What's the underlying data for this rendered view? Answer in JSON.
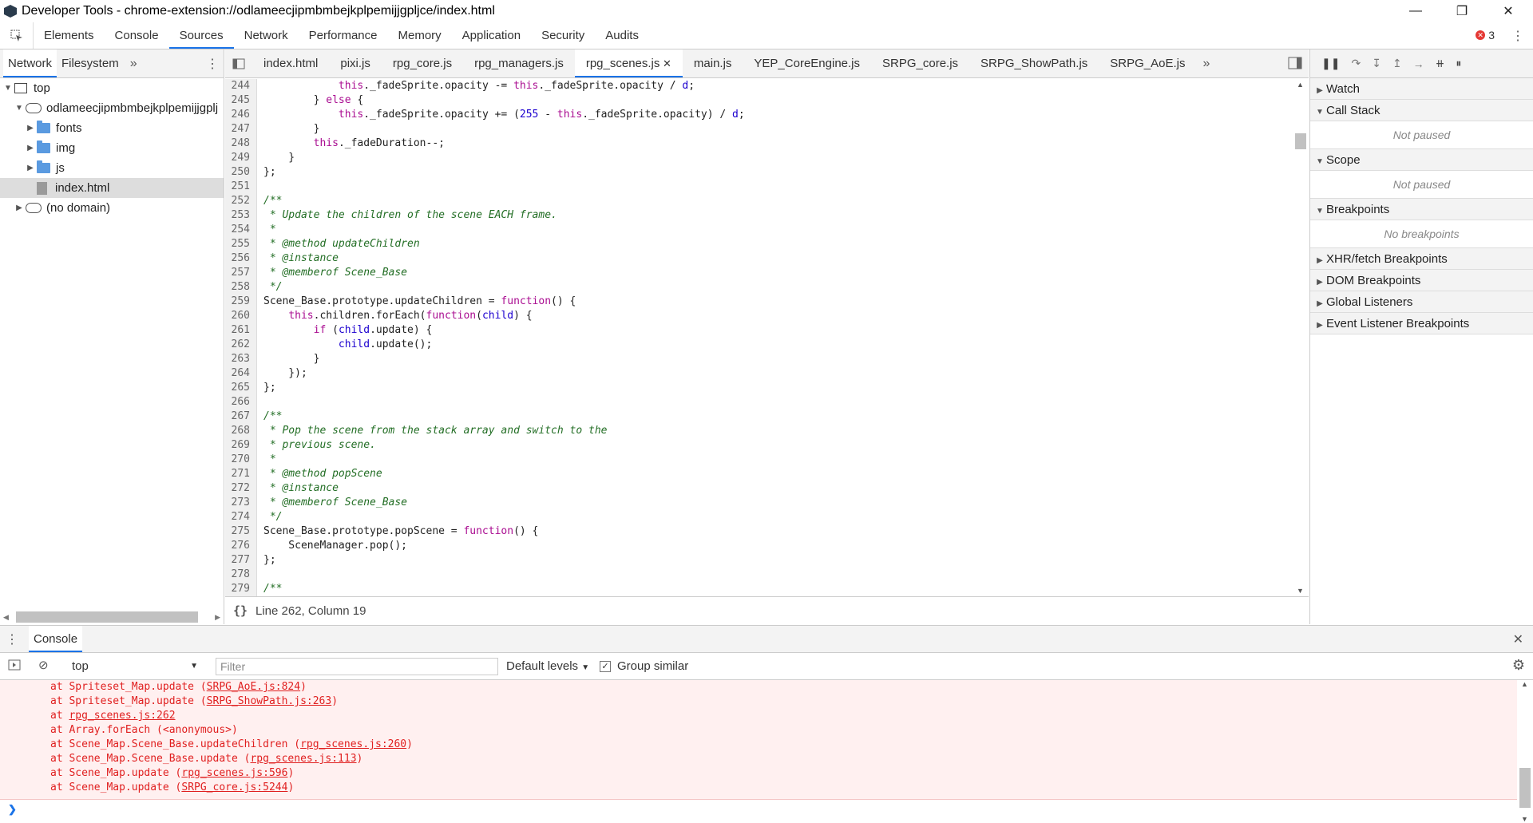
{
  "window": {
    "title": "Developer Tools - chrome-extension://odlameecjipmbmbejkplpemijjgpljce/index.html"
  },
  "main_tabs": [
    "Elements",
    "Console",
    "Sources",
    "Network",
    "Performance",
    "Memory",
    "Application",
    "Security",
    "Audits"
  ],
  "active_main_tab": "Sources",
  "error_count": "3",
  "navigator": {
    "tabs": [
      "Network",
      "Filesystem"
    ],
    "tree": [
      {
        "label": "top",
        "depth": 0,
        "kind": "frame",
        "open": true
      },
      {
        "label": "odlameecjipmbmbejkplpemijjgplj",
        "depth": 1,
        "kind": "cloud",
        "open": true
      },
      {
        "label": "fonts",
        "depth": 2,
        "kind": "folder",
        "open": false
      },
      {
        "label": "img",
        "depth": 2,
        "kind": "folder",
        "open": false
      },
      {
        "label": "js",
        "depth": 2,
        "kind": "folder",
        "open": false
      },
      {
        "label": "index.html",
        "depth": 2,
        "kind": "file",
        "selected": true
      },
      {
        "label": "(no domain)",
        "depth": 1,
        "kind": "cloud",
        "open": false
      }
    ]
  },
  "file_tabs": [
    "index.html",
    "pixi.js",
    "rpg_core.js",
    "rpg_managers.js",
    "rpg_scenes.js",
    "main.js",
    "YEP_CoreEngine.js",
    "SRPG_core.js",
    "SRPG_ShowPath.js",
    "SRPG_AoE.js"
  ],
  "active_file_tab": "rpg_scenes.js",
  "code_lines": [
    [
      "244",
      "            this._fadeSprite.opacity -= this._fadeSprite.opacity / d;"
    ],
    [
      "245",
      "        } else {"
    ],
    [
      "246",
      "            this._fadeSprite.opacity += (255 - this._fadeSprite.opacity) / d;"
    ],
    [
      "247",
      "        }"
    ],
    [
      "248",
      "        this._fadeDuration--;"
    ],
    [
      "249",
      "    }"
    ],
    [
      "250",
      "};"
    ],
    [
      "251",
      ""
    ],
    [
      "252",
      "/**"
    ],
    [
      "253",
      " * Update the children of the scene EACH frame."
    ],
    [
      "254",
      " *"
    ],
    [
      "255",
      " * @method updateChildren"
    ],
    [
      "256",
      " * @instance"
    ],
    [
      "257",
      " * @memberof Scene_Base"
    ],
    [
      "258",
      " */"
    ],
    [
      "259",
      "Scene_Base.prototype.updateChildren = function() {"
    ],
    [
      "260",
      "    this.children.forEach(function(child) {"
    ],
    [
      "261",
      "        if (child.update) {"
    ],
    [
      "262",
      "            child.update();"
    ],
    [
      "263",
      "        }"
    ],
    [
      "264",
      "    });"
    ],
    [
      "265",
      "};"
    ],
    [
      "266",
      ""
    ],
    [
      "267",
      "/**"
    ],
    [
      "268",
      " * Pop the scene from the stack array and switch to the"
    ],
    [
      "269",
      " * previous scene."
    ],
    [
      "270",
      " *"
    ],
    [
      "271",
      " * @method popScene"
    ],
    [
      "272",
      " * @instance"
    ],
    [
      "273",
      " * @memberof Scene_Base"
    ],
    [
      "274",
      " */"
    ],
    [
      "275",
      "Scene_Base.prototype.popScene = function() {"
    ],
    [
      "276",
      "    SceneManager.pop();"
    ],
    [
      "277",
      "};"
    ],
    [
      "278",
      ""
    ],
    [
      "279",
      "/**"
    ]
  ],
  "editor_status": "Line 262, Column 19",
  "debugger": {
    "sections": [
      {
        "label": "Watch",
        "open": false
      },
      {
        "label": "Call Stack",
        "open": true,
        "note": "Not paused"
      },
      {
        "label": "Scope",
        "open": true,
        "note": "Not paused"
      },
      {
        "label": "Breakpoints",
        "open": true,
        "note": "No breakpoints"
      },
      {
        "label": "XHR/fetch Breakpoints",
        "open": false
      },
      {
        "label": "DOM Breakpoints",
        "open": false
      },
      {
        "label": "Global Listeners",
        "open": false
      },
      {
        "label": "Event Listener Breakpoints",
        "open": false
      }
    ]
  },
  "console": {
    "tab": "Console",
    "context": "top",
    "filter_placeholder": "Filter",
    "levels": "Default levels",
    "group_similar": "Group similar",
    "lines": [
      {
        "text": "at Spriteset_Map.update ",
        "link": "SRPG_AoE.js:824"
      },
      {
        "text": "at Spriteset_Map.update ",
        "link": "SRPG_ShowPath.js:263"
      },
      {
        "text": "at ",
        "link": "rpg_scenes.js:262",
        "plain": true
      },
      {
        "text": "at Array.forEach (<anonymous>)",
        "link": ""
      },
      {
        "text": "at Scene_Map.Scene_Base.updateChildren ",
        "link": "rpg_scenes.js:260"
      },
      {
        "text": "at Scene_Map.Scene_Base.update ",
        "link": "rpg_scenes.js:113"
      },
      {
        "text": "at Scene_Map.update ",
        "link": "rpg_scenes.js:596"
      },
      {
        "text": "at Scene_Map.update ",
        "link": "SRPG_core.js:5244"
      }
    ]
  }
}
